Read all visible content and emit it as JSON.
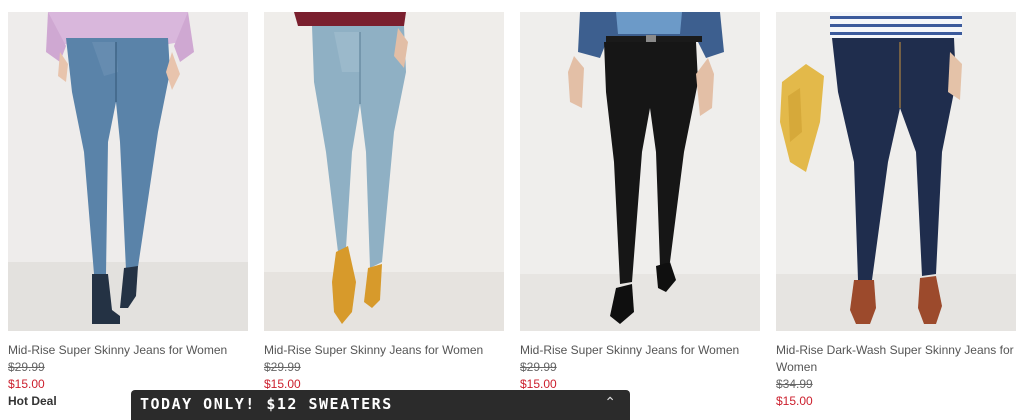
{
  "products": [
    {
      "name": "Mid-Rise Super Skinny Jeans for Women",
      "was_price": "$29.99",
      "sale_price": "$15.00",
      "badge": "Hot Deal",
      "image": "woman-medium-wash-skinny-jeans-navy-suede-booties"
    },
    {
      "name": "Mid-Rise Super Skinny Jeans for Women",
      "was_price": "$29.99",
      "sale_price": "$15.00",
      "badge": "",
      "image": "woman-light-wash-skinny-jeans-mustard-heels"
    },
    {
      "name": "Mid-Rise Super Skinny Jeans for Women",
      "was_price": "$29.99",
      "sale_price": "$15.00",
      "badge": "",
      "image": "woman-black-skinny-jeans-black-sandals"
    },
    {
      "name": "Mid-Rise Dark-Wash Super Skinny Jeans for Women",
      "was_price": "$34.99",
      "sale_price": "$15.00",
      "badge": "",
      "image": "woman-dark-wash-skinny-jeans-brown-sandals"
    }
  ],
  "promo_banner": {
    "text": "TODAY ONLY! $12 SWEATERS",
    "icon": "chevron-up-icon"
  },
  "colors": {
    "sale_price": "#cc1f2d",
    "banner_bg": "#2b2b2b"
  }
}
